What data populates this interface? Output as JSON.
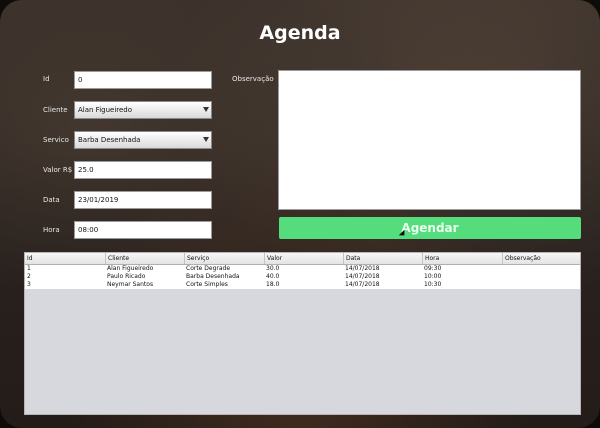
{
  "title": "Agenda",
  "form": {
    "id_label": "Id",
    "id_value": "0",
    "cliente_label": "Cliente",
    "cliente_value": "Alan Figueiredo",
    "servico_label": "Servico",
    "servico_value": "Barba Desenhada",
    "valor_label": "Valor R$",
    "valor_value": "25.0",
    "data_label": "Data",
    "data_value": "23/01/2019",
    "hora_label": "Hora",
    "hora_value": "08:00",
    "observacao_label": "Observação",
    "observacao_value": ""
  },
  "button": {
    "label": "Agendar",
    "color": "#55dc7c"
  },
  "table": {
    "headers": [
      "Id",
      "Cliente",
      "Serviço",
      "Valor",
      "Data",
      "Hora",
      "Observação"
    ],
    "rows": [
      [
        "1",
        "Alan Figueiredo",
        "Corte Degrade",
        "30.0",
        "14/07/2018",
        "09:30",
        ""
      ],
      [
        "2",
        "Paulo Ricado",
        "Barba Desenhada",
        "40.0",
        "14/07/2018",
        "10:00",
        ""
      ],
      [
        "3",
        "Neymar Santos",
        "Corte Simples",
        "18.0",
        "14/07/2018",
        "10:30",
        ""
      ]
    ]
  }
}
